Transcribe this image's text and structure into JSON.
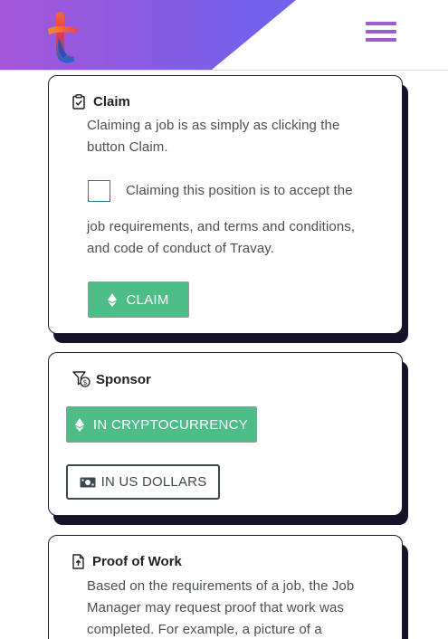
{
  "header": {
    "logo": "travay-logo",
    "menu_icon": "hamburger-menu-icon",
    "colors": {
      "gradient_start": "#a455d8",
      "gradient_end": "#6d63ee",
      "menu": "#a05bd0"
    }
  },
  "claim": {
    "icon": "clipboard-check-icon",
    "title": "Claim",
    "body_line1": "Claiming a job is as simply as clicking the",
    "body_line2": "button Claim.",
    "checkbox_label": "Claiming this position is to accept the",
    "terms_line1": "job requirements, and terms and conditions,",
    "terms_line2": "and code of conduct of Travay.",
    "button_icon": "ethereum-icon",
    "button_label": "CLAIM"
  },
  "sponsor": {
    "icon": "dollar-filter-icon",
    "title": "Sponsor",
    "crypto_icon": "ethereum-icon",
    "crypto_label": "IN CRYPTOCURRENCY",
    "usd_icon": "banknote-icon",
    "usd_label": "IN US DOLLARS"
  },
  "proof": {
    "icon": "file-upload-icon",
    "title": "Proof of Work",
    "line1": "Based on the requirements of a job, the Job",
    "line2": "Manager may request proof that work was",
    "line3": "completed. For example, a picture of a"
  },
  "colors": {
    "accent_green": "#4dbd88",
    "card_shadow": "#14132a",
    "checkbox_border": "#1f7e8a"
  }
}
